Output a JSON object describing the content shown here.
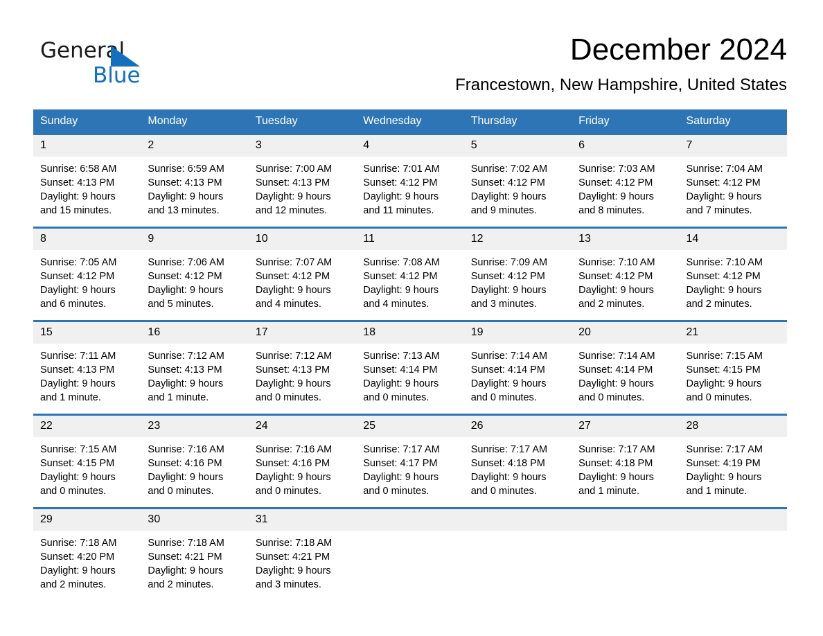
{
  "brand": {
    "name_top": "General",
    "name_bottom": "Blue",
    "accent_color": "#1270bd"
  },
  "header": {
    "month_title": "December 2024",
    "location": "Francestown, New Hampshire, United States"
  },
  "theme": {
    "header_blue": "#2e75b6",
    "daynum_band": "#f0f0f0",
    "page_background": "#ffffff"
  },
  "weekday_headers": [
    "Sunday",
    "Monday",
    "Tuesday",
    "Wednesday",
    "Thursday",
    "Friday",
    "Saturday"
  ],
  "weeks": [
    [
      {
        "day": "1",
        "sunrise": "Sunrise: 6:58 AM",
        "sunset": "Sunset: 4:13 PM",
        "daylight_line1": "Daylight: 9 hours",
        "daylight_line2": "and 15 minutes."
      },
      {
        "day": "2",
        "sunrise": "Sunrise: 6:59 AM",
        "sunset": "Sunset: 4:13 PM",
        "daylight_line1": "Daylight: 9 hours",
        "daylight_line2": "and 13 minutes."
      },
      {
        "day": "3",
        "sunrise": "Sunrise: 7:00 AM",
        "sunset": "Sunset: 4:13 PM",
        "daylight_line1": "Daylight: 9 hours",
        "daylight_line2": "and 12 minutes."
      },
      {
        "day": "4",
        "sunrise": "Sunrise: 7:01 AM",
        "sunset": "Sunset: 4:12 PM",
        "daylight_line1": "Daylight: 9 hours",
        "daylight_line2": "and 11 minutes."
      },
      {
        "day": "5",
        "sunrise": "Sunrise: 7:02 AM",
        "sunset": "Sunset: 4:12 PM",
        "daylight_line1": "Daylight: 9 hours",
        "daylight_line2": "and 9 minutes."
      },
      {
        "day": "6",
        "sunrise": "Sunrise: 7:03 AM",
        "sunset": "Sunset: 4:12 PM",
        "daylight_line1": "Daylight: 9 hours",
        "daylight_line2": "and 8 minutes."
      },
      {
        "day": "7",
        "sunrise": "Sunrise: 7:04 AM",
        "sunset": "Sunset: 4:12 PM",
        "daylight_line1": "Daylight: 9 hours",
        "daylight_line2": "and 7 minutes."
      }
    ],
    [
      {
        "day": "8",
        "sunrise": "Sunrise: 7:05 AM",
        "sunset": "Sunset: 4:12 PM",
        "daylight_line1": "Daylight: 9 hours",
        "daylight_line2": "and 6 minutes."
      },
      {
        "day": "9",
        "sunrise": "Sunrise: 7:06 AM",
        "sunset": "Sunset: 4:12 PM",
        "daylight_line1": "Daylight: 9 hours",
        "daylight_line2": "and 5 minutes."
      },
      {
        "day": "10",
        "sunrise": "Sunrise: 7:07 AM",
        "sunset": "Sunset: 4:12 PM",
        "daylight_line1": "Daylight: 9 hours",
        "daylight_line2": "and 4 minutes."
      },
      {
        "day": "11",
        "sunrise": "Sunrise: 7:08 AM",
        "sunset": "Sunset: 4:12 PM",
        "daylight_line1": "Daylight: 9 hours",
        "daylight_line2": "and 4 minutes."
      },
      {
        "day": "12",
        "sunrise": "Sunrise: 7:09 AM",
        "sunset": "Sunset: 4:12 PM",
        "daylight_line1": "Daylight: 9 hours",
        "daylight_line2": "and 3 minutes."
      },
      {
        "day": "13",
        "sunrise": "Sunrise: 7:10 AM",
        "sunset": "Sunset: 4:12 PM",
        "daylight_line1": "Daylight: 9 hours",
        "daylight_line2": "and 2 minutes."
      },
      {
        "day": "14",
        "sunrise": "Sunrise: 7:10 AM",
        "sunset": "Sunset: 4:12 PM",
        "daylight_line1": "Daylight: 9 hours",
        "daylight_line2": "and 2 minutes."
      }
    ],
    [
      {
        "day": "15",
        "sunrise": "Sunrise: 7:11 AM",
        "sunset": "Sunset: 4:13 PM",
        "daylight_line1": "Daylight: 9 hours",
        "daylight_line2": "and 1 minute."
      },
      {
        "day": "16",
        "sunrise": "Sunrise: 7:12 AM",
        "sunset": "Sunset: 4:13 PM",
        "daylight_line1": "Daylight: 9 hours",
        "daylight_line2": "and 1 minute."
      },
      {
        "day": "17",
        "sunrise": "Sunrise: 7:12 AM",
        "sunset": "Sunset: 4:13 PM",
        "daylight_line1": "Daylight: 9 hours",
        "daylight_line2": "and 0 minutes."
      },
      {
        "day": "18",
        "sunrise": "Sunrise: 7:13 AM",
        "sunset": "Sunset: 4:14 PM",
        "daylight_line1": "Daylight: 9 hours",
        "daylight_line2": "and 0 minutes."
      },
      {
        "day": "19",
        "sunrise": "Sunrise: 7:14 AM",
        "sunset": "Sunset: 4:14 PM",
        "daylight_line1": "Daylight: 9 hours",
        "daylight_line2": "and 0 minutes."
      },
      {
        "day": "20",
        "sunrise": "Sunrise: 7:14 AM",
        "sunset": "Sunset: 4:14 PM",
        "daylight_line1": "Daylight: 9 hours",
        "daylight_line2": "and 0 minutes."
      },
      {
        "day": "21",
        "sunrise": "Sunrise: 7:15 AM",
        "sunset": "Sunset: 4:15 PM",
        "daylight_line1": "Daylight: 9 hours",
        "daylight_line2": "and 0 minutes."
      }
    ],
    [
      {
        "day": "22",
        "sunrise": "Sunrise: 7:15 AM",
        "sunset": "Sunset: 4:15 PM",
        "daylight_line1": "Daylight: 9 hours",
        "daylight_line2": "and 0 minutes."
      },
      {
        "day": "23",
        "sunrise": "Sunrise: 7:16 AM",
        "sunset": "Sunset: 4:16 PM",
        "daylight_line1": "Daylight: 9 hours",
        "daylight_line2": "and 0 minutes."
      },
      {
        "day": "24",
        "sunrise": "Sunrise: 7:16 AM",
        "sunset": "Sunset: 4:16 PM",
        "daylight_line1": "Daylight: 9 hours",
        "daylight_line2": "and 0 minutes."
      },
      {
        "day": "25",
        "sunrise": "Sunrise: 7:17 AM",
        "sunset": "Sunset: 4:17 PM",
        "daylight_line1": "Daylight: 9 hours",
        "daylight_line2": "and 0 minutes."
      },
      {
        "day": "26",
        "sunrise": "Sunrise: 7:17 AM",
        "sunset": "Sunset: 4:18 PM",
        "daylight_line1": "Daylight: 9 hours",
        "daylight_line2": "and 0 minutes."
      },
      {
        "day": "27",
        "sunrise": "Sunrise: 7:17 AM",
        "sunset": "Sunset: 4:18 PM",
        "daylight_line1": "Daylight: 9 hours",
        "daylight_line2": "and 1 minute."
      },
      {
        "day": "28",
        "sunrise": "Sunrise: 7:17 AM",
        "sunset": "Sunset: 4:19 PM",
        "daylight_line1": "Daylight: 9 hours",
        "daylight_line2": "and 1 minute."
      }
    ],
    [
      {
        "day": "29",
        "sunrise": "Sunrise: 7:18 AM",
        "sunset": "Sunset: 4:20 PM",
        "daylight_line1": "Daylight: 9 hours",
        "daylight_line2": "and 2 minutes."
      },
      {
        "day": "30",
        "sunrise": "Sunrise: 7:18 AM",
        "sunset": "Sunset: 4:21 PM",
        "daylight_line1": "Daylight: 9 hours",
        "daylight_line2": "and 2 minutes."
      },
      {
        "day": "31",
        "sunrise": "Sunrise: 7:18 AM",
        "sunset": "Sunset: 4:21 PM",
        "daylight_line1": "Daylight: 9 hours",
        "daylight_line2": "and 3 minutes."
      },
      {
        "day": "",
        "sunrise": "",
        "sunset": "",
        "daylight_line1": "",
        "daylight_line2": ""
      },
      {
        "day": "",
        "sunrise": "",
        "sunset": "",
        "daylight_line1": "",
        "daylight_line2": ""
      },
      {
        "day": "",
        "sunrise": "",
        "sunset": "",
        "daylight_line1": "",
        "daylight_line2": ""
      },
      {
        "day": "",
        "sunrise": "",
        "sunset": "",
        "daylight_line1": "",
        "daylight_line2": ""
      }
    ]
  ]
}
